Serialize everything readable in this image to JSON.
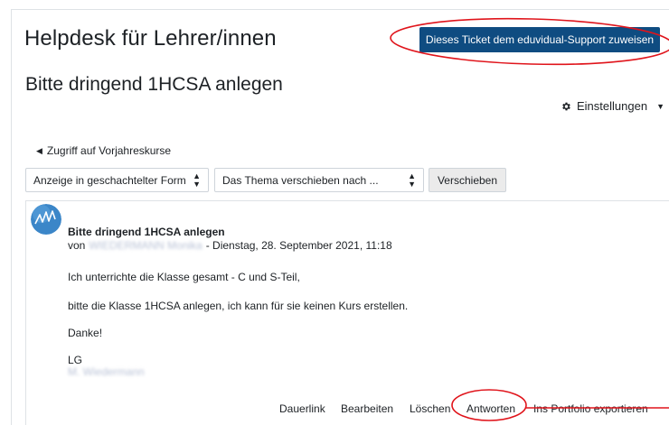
{
  "header": {
    "site_title": "Helpdesk für Lehrer/innen",
    "assign_button": "Dieses Ticket dem eduvidual-Support zuweisen"
  },
  "discussion": {
    "title": "Bitte dringend 1HCSA anlegen"
  },
  "settings": {
    "label": "Einstellungen",
    "icon": "gear-icon"
  },
  "nav": {
    "previous_link": "Zugriff auf Vorjahreskurse"
  },
  "controls": {
    "display_mode": "Anzeige in geschachtelter Form",
    "move_placeholder": "Das Thema verschieben nach ...",
    "move_button": "Verschieben"
  },
  "post": {
    "subject": "Bitte dringend 1HCSA anlegen",
    "by_prefix": "von",
    "author": "WIEDERMANN Monika",
    "date": "- Dienstag, 28. September 2021, 11:18",
    "body": [
      "Ich unterrichte die Klasse gesamt - C und S-Teil,",
      "bitte die Klasse 1HCSA anlegen, ich kann für sie keinen Kurs erstellen.",
      "Danke!"
    ],
    "signature_greeting": "LG",
    "signature_name": "M. Wiedermann"
  },
  "actions": {
    "permalink": "Dauerlink",
    "edit": "Bearbeiten",
    "delete": "Löschen",
    "reply": "Antworten",
    "export": "Ins Portfolio exportieren"
  },
  "colors": {
    "primary_button": "#0f4c81",
    "annotation_red": "#e0141b",
    "avatar_blue": "#3b86c8"
  }
}
